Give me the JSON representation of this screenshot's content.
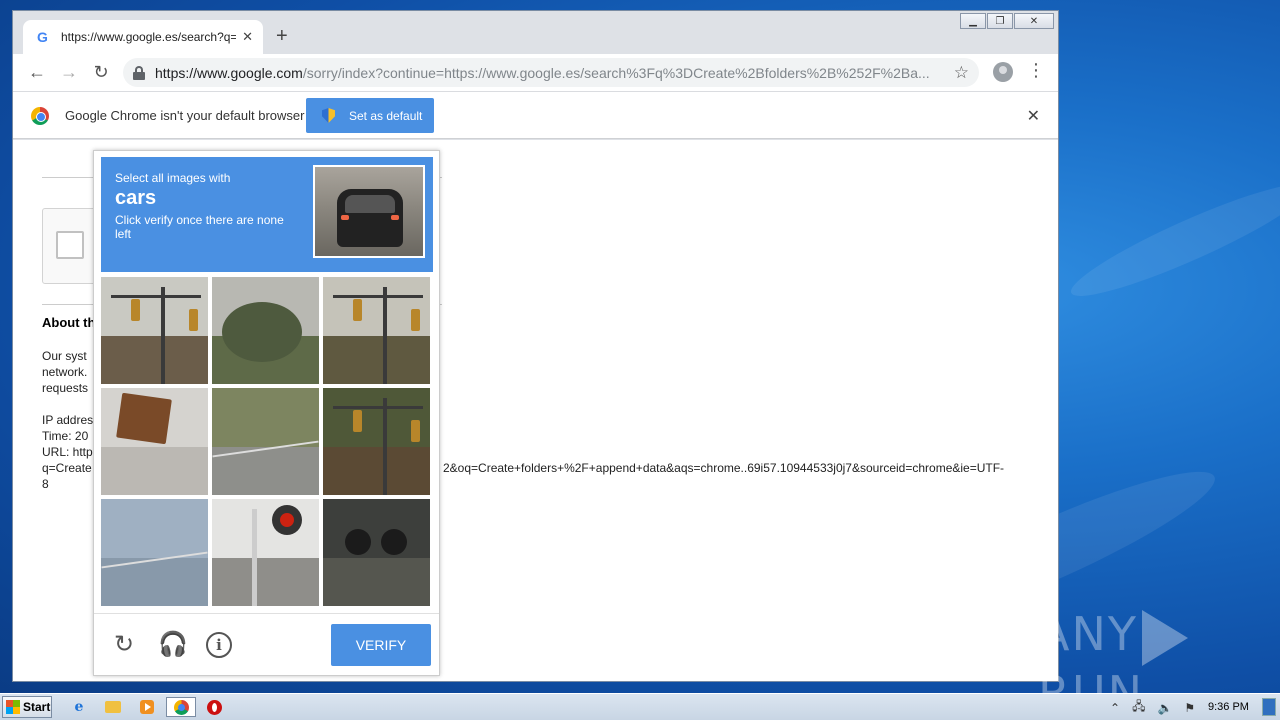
{
  "browser": {
    "tab": {
      "title": "https://www.google.es/search?q=Cr",
      "favicon": "google-g-icon"
    },
    "address": {
      "host": "https://www.google.com",
      "path": "/sorry/index?continue=https://www.google.es/search%3Fq%3DCreate%2Bfolders%2B%252F%2Ba..."
    },
    "window_controls": [
      "minimize",
      "restore",
      "close"
    ]
  },
  "infobar": {
    "message": "Google Chrome isn't your default browser",
    "button_label": "Set as default"
  },
  "page": {
    "about_heading": "About th",
    "body_lines": [
      "Our syst",
      "network.",
      "requests"
    ],
    "ip_label": "IP addres",
    "time_label": "Time: 20",
    "url_label": "URL: http",
    "url_line_start": "q=Create",
    "url_line_end": "2&oq=Create+folders+%2F+append+data&aqs=chrome..69i57.10944533j0j7&sourceid=chrome&ie=UTF-",
    "url_wrap": "8"
  },
  "captcha": {
    "instruction_line1": "Select all images with",
    "keyword": "cars",
    "instruction_line2": "Click verify once there are none left",
    "verify_label": "VERIFY",
    "tiles": [
      {
        "scene": "traffic-signal-pole",
        "sky": "#c9c9c2",
        "ground": "#6b5d4a"
      },
      {
        "scene": "street-tree",
        "sky": "#b8b8b2",
        "ground": "#5e6a48"
      },
      {
        "scene": "traffic-light-trees",
        "sky": "#c5c3b9",
        "ground": "#5f5940"
      },
      {
        "scene": "sign-closeup",
        "sky": "#d5d3cf",
        "ground": "#bbb8b3"
      },
      {
        "scene": "road-shoulder",
        "sky": "#7d8560",
        "ground": "#8e8f8b"
      },
      {
        "scene": "signal-forest",
        "sky": "#4f5838",
        "ground": "#5b4a34"
      },
      {
        "scene": "bridge-road",
        "sky": "#9fb0c2",
        "ground": "#8899aa"
      },
      {
        "scene": "railroad-crossing",
        "sky": "#e4e4e2",
        "ground": "#8f8e8a"
      },
      {
        "scene": "crossing-signals-dark",
        "sky": "#3d3f3c",
        "ground": "#55564f"
      }
    ]
  },
  "taskbar": {
    "start_label": "Start",
    "clock": "9:36 PM"
  },
  "watermark": {
    "left": "ANY",
    "right": "RUN"
  }
}
